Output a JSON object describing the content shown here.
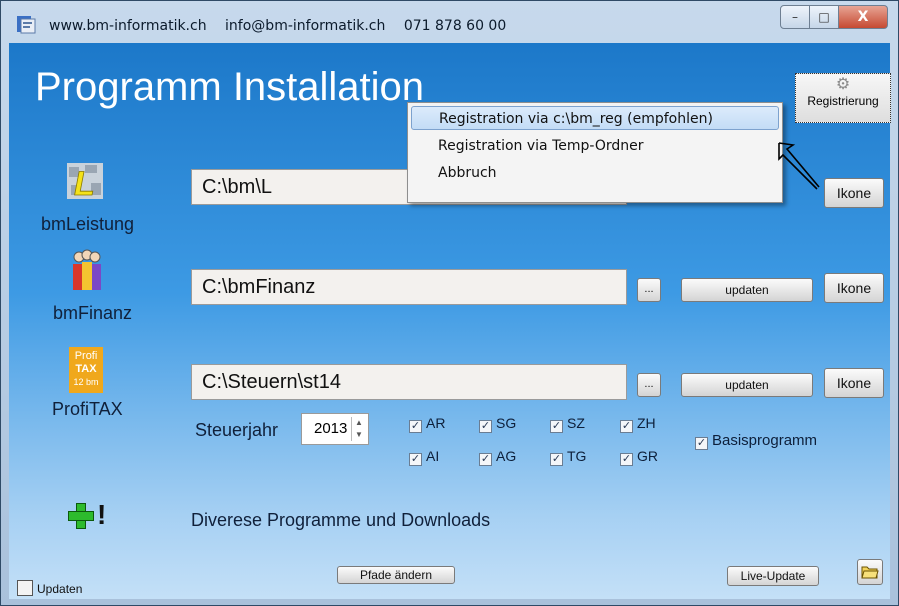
{
  "window": {
    "title_parts": [
      "www.bm-informatik.ch",
      "info@bm-informatik.ch",
      "071 878 60 00"
    ],
    "minimize_label": "–",
    "maximize_label": "□",
    "close_label": "X"
  },
  "heading": "Programm Installation",
  "registration_button": {
    "label": "Registrierung",
    "icon": "gear-icon"
  },
  "apps": [
    {
      "name": "bmLeistung",
      "path": "C:\\bm\\L",
      "ikone_label": "Ikone"
    },
    {
      "name": "bmFinanz",
      "path": "C:\\bmFinanz",
      "dots_label": "...",
      "update_label": "updaten",
      "ikone_label": "Ikone"
    },
    {
      "name": "ProfiTAX",
      "path": "C:\\Steuern\\st14",
      "dots_label": "...",
      "update_label": "updaten",
      "ikone_label": "Ikone"
    }
  ],
  "profitax_logo": {
    "line1": "Profi",
    "line2": "TAX",
    "line3": "12 bm"
  },
  "steuerjahr": {
    "label": "Steuerjahr",
    "value": "2013"
  },
  "cantons": {
    "row1": [
      "AR",
      "SG",
      "SZ",
      "ZH"
    ],
    "row2": [
      "AI",
      "AG",
      "TG",
      "GR"
    ]
  },
  "basisprogramm_label": "Basisprogramm",
  "diverse_label": "Diverese Programme und Downloads",
  "bottom": {
    "updaten_label": "Updaten",
    "pfade_label": "Pfade ändern",
    "live_update_label": "Live-Update"
  },
  "context_menu": {
    "items": [
      "Registration via c:\\bm_reg (empfohlen)",
      "Registration via Temp-Ordner",
      "Abbruch"
    ],
    "selected_index": 0
  },
  "colors": {
    "accent_blue": "#1c78c9",
    "menu_highlight": "#c3dcf6",
    "plus_green": "#2dbb2d"
  }
}
